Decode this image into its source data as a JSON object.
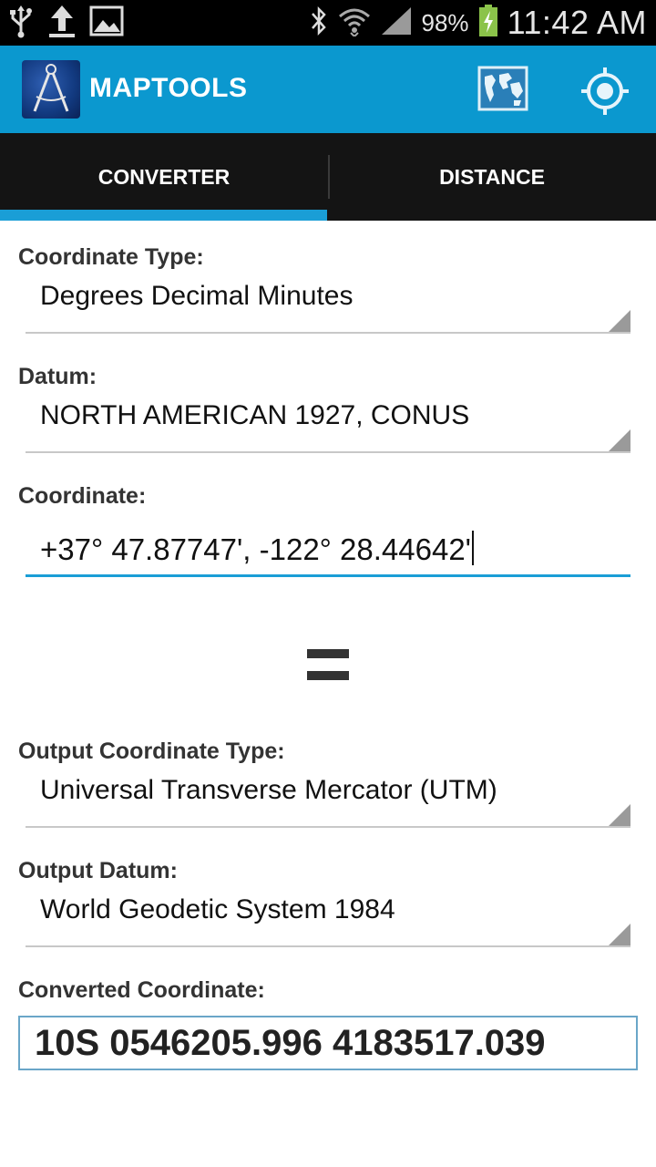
{
  "status_bar": {
    "left_icons": [
      "usb-icon",
      "upload-icon",
      "image-icon"
    ],
    "right_icons": [
      "bluetooth-icon",
      "wifi-icon",
      "signal-icon",
      "battery-charging-icon"
    ],
    "battery_percent": "98%",
    "time": "11:42 AM"
  },
  "action_bar": {
    "title": "MAPTOOLS",
    "icons": [
      "app-logo-compass-icon",
      "world-map-icon",
      "locate-target-icon"
    ],
    "background": "#0b98cf"
  },
  "tabs": [
    {
      "label": "CONVERTER",
      "selected": true
    },
    {
      "label": "DISTANCE",
      "selected": false
    }
  ],
  "form": {
    "coordinate_type_label": "Coordinate Type:",
    "coordinate_type_value": "Degrees Decimal Minutes",
    "datum_label": "Datum:",
    "datum_value": "NORTH AMERICAN 1927, CONUS",
    "coordinate_label": "Coordinate:",
    "coordinate_value": "+37° 47.87747', -122° 28.44642'",
    "equals_symbol": "=",
    "output_coordinate_type_label": "Output Coordinate Type:",
    "output_coordinate_type_value": "Universal Transverse Mercator (UTM)",
    "output_datum_label": "Output Datum:",
    "output_datum_value": "World Geodetic System 1984",
    "converted_label": "Converted Coordinate:",
    "converted_value": "10S 0546205.996 4183517.039"
  },
  "colors": {
    "accent": "#1a9ed6",
    "tab_background": "#141414",
    "label_text": "#333333"
  }
}
